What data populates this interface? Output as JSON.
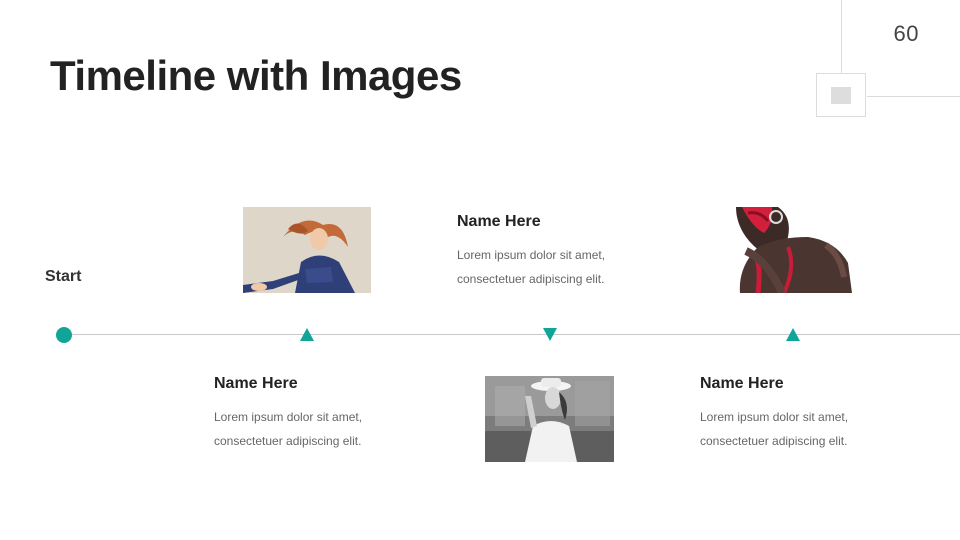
{
  "slide": {
    "title": "Timeline with Images",
    "page_number": "60"
  },
  "timeline": {
    "start_label": "Start",
    "accent_color": "#11a59a",
    "items": [
      {
        "name": "Name Here",
        "description": "Lorem ipsum dolor sit amet, consectetuer adipiscing elit."
      },
      {
        "name": "Name Here",
        "description": "Lorem ipsum dolor sit amet, consectetuer adipiscing elit."
      },
      {
        "name": "Name Here",
        "description": "Lorem ipsum dolor sit amet, consectetuer adipiscing elit."
      }
    ],
    "markers": [
      "triangle-up",
      "triangle-down",
      "triangle-up"
    ]
  },
  "photos": [
    {
      "subject": "woman with flowing red hair in blue jacket",
      "style": "color"
    },
    {
      "subject": "woman in white hat",
      "style": "black-and-white"
    },
    {
      "subject": "person with red face paint and earring",
      "style": "color"
    }
  ]
}
